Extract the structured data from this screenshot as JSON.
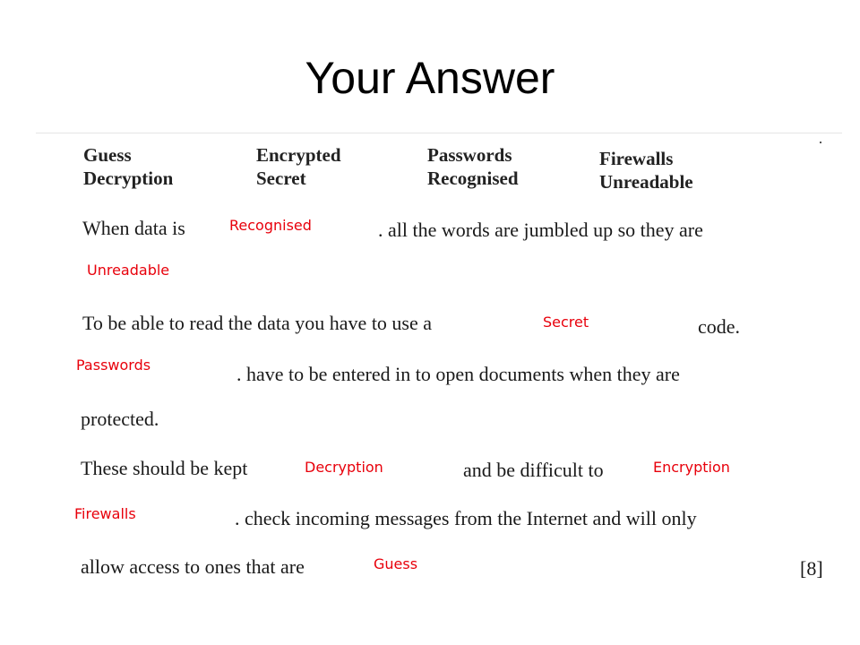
{
  "title": "Your Answer",
  "word_bank": [
    [
      "Guess",
      "Decryption"
    ],
    [
      "Encrypted",
      "Secret"
    ],
    [
      "Passwords",
      "Recognised"
    ],
    [
      "Firewalls",
      "Unreadable"
    ]
  ],
  "sentences": {
    "s1a": "When data is",
    "s1b": ". all the words are jumbled up so they are",
    "s2a": "To be able to read the data you have to use a",
    "s2b": "code.",
    "s3a": ". have to be entered in to open documents when they are",
    "s3b": "protected.",
    "s4a": "These should be kept",
    "s4b": "and be difficult to",
    "s5a": ". check incoming messages from the Internet and will only",
    "s6a": "allow access to ones that are"
  },
  "answers": {
    "a1": "Recognised",
    "a2": "Unreadable",
    "a3": "Secret",
    "a4": "Passwords",
    "a5": "Decryption",
    "a6": "Encryption",
    "a7": "Firewalls",
    "a8": "Guess"
  },
  "marks": "[8]",
  "colors": {
    "answer": "#e8000b"
  }
}
